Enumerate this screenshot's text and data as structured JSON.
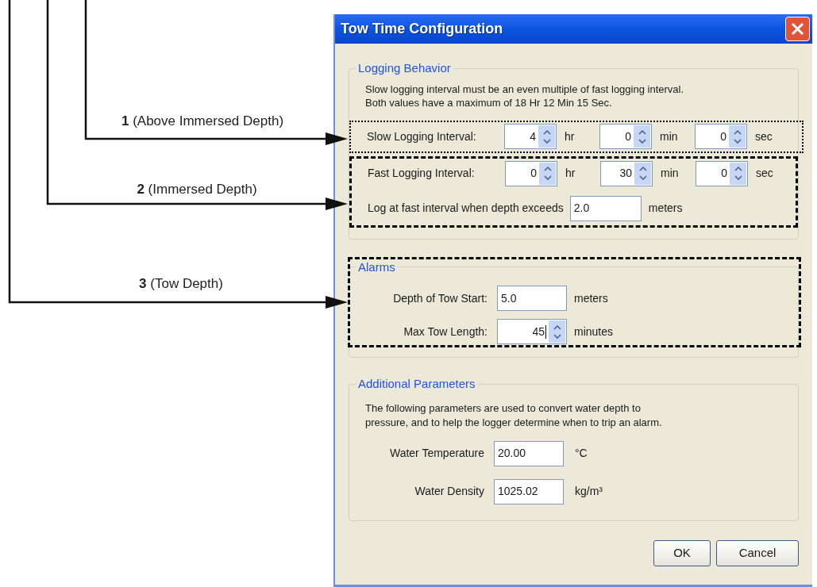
{
  "annotations": [
    {
      "label": "**1** (Above Immersed Depth)"
    },
    {
      "label": "**2** (Immersed Depth)"
    },
    {
      "label": "**3** (Tow Depth)"
    }
  ],
  "dialog": {
    "title": "Tow Time Configuration",
    "logging": {
      "legend": "Logging Behavior",
      "note": [
        "Slow logging interval must be an even multiple of fast logging interval.",
        "Both values have a maximum of 18 Hr 12 Min 15 Sec."
      ],
      "slow": {
        "kind": "dotted",
        "label": "Slow Logging Interval:",
        "spinners": [
          {
            "value": "4",
            "unit": "hr"
          },
          {
            "value": "0",
            "unit": "min"
          },
          {
            "value": "0",
            "unit": "sec"
          }
        ]
      },
      "fast": {
        "kind": "dashed",
        "label": "Fast Logging Interval:",
        "spinners": [
          {
            "value": "0",
            "unit": "hr"
          },
          {
            "value": "30",
            "unit": "min"
          },
          {
            "value": "0",
            "unit": "sec"
          }
        ],
        "threshold": {
          "label": "Log at fast interval when depth exceeds",
          "value": "2.0",
          "unit": "meters"
        }
      }
    },
    "alarms": {
      "legend": "Alarms",
      "kind": "dashed",
      "depth_start": {
        "label": "Depth of Tow Start:",
        "value": "5.0",
        "unit": "meters"
      },
      "max_length": {
        "label": "Max Tow Length:",
        "value": "45",
        "unit": "minutes",
        "focused": true
      }
    },
    "additional": {
      "legend": "Additional Parameters",
      "note": [
        "The following parameters are used to convert water depth to",
        "pressure, and to help the logger determine when to trip an alarm."
      ],
      "fields": [
        {
          "label": "Water Temperature",
          "value": "20.00",
          "unit": "°C"
        },
        {
          "label": "Water Density",
          "value": "1025.02",
          "unit": "kg/m³"
        }
      ]
    },
    "buttons": [
      "OK",
      "Cancel"
    ]
  }
}
